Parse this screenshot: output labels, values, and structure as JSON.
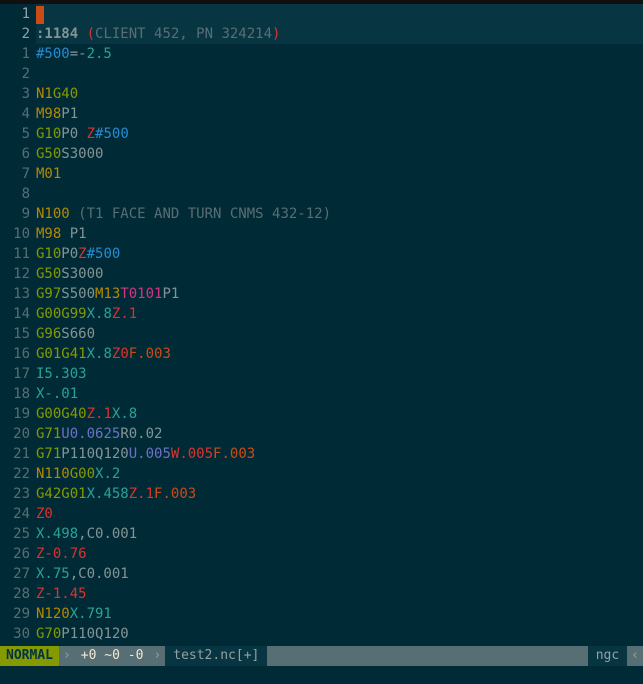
{
  "header_gutter": [
    "1",
    "2"
  ],
  "header_lines": [
    [],
    [
      {
        "t": ":1184 ",
        "c": "t-base0 t-bold"
      },
      {
        "t": "(",
        "c": "paren-hl"
      },
      {
        "t": "CLIENT 452, PN 324214",
        "c": "t-base01"
      },
      {
        "t": ")",
        "c": "paren-hl"
      }
    ]
  ],
  "cursor_line_index": 1,
  "lines": [
    [
      {
        "t": "#500",
        "c": "t-blue"
      },
      {
        "t": "=-",
        "c": "t-base0"
      },
      {
        "t": "2.5",
        "c": "t-cyan"
      }
    ],
    [],
    [
      {
        "t": "N1",
        "c": "t-yellow"
      },
      {
        "t": "G40",
        "c": "t-green"
      }
    ],
    [
      {
        "t": "M98",
        "c": "t-yellow"
      },
      {
        "t": "P1",
        "c": "t-base0"
      }
    ],
    [
      {
        "t": "G10",
        "c": "t-green"
      },
      {
        "t": "P0",
        "c": "t-base0"
      },
      {
        "t": " ",
        "c": ""
      },
      {
        "t": "Z",
        "c": "t-red"
      },
      {
        "t": "#500",
        "c": "t-blue"
      }
    ],
    [
      {
        "t": "G50",
        "c": "t-green"
      },
      {
        "t": "S3000",
        "c": "t-base0"
      }
    ],
    [
      {
        "t": "M01",
        "c": "t-yellow"
      }
    ],
    [],
    [
      {
        "t": "N100",
        "c": "t-yellow"
      },
      {
        "t": " ",
        "c": ""
      },
      {
        "t": "(T1 FACE AND TURN CNMS 432-12)",
        "c": "t-base01"
      }
    ],
    [
      {
        "t": "M98",
        "c": "t-yellow"
      },
      {
        "t": " P1",
        "c": "t-base0"
      }
    ],
    [
      {
        "t": "G10",
        "c": "t-green"
      },
      {
        "t": "P0",
        "c": "t-base0"
      },
      {
        "t": "Z",
        "c": "t-red"
      },
      {
        "t": "#500",
        "c": "t-blue"
      }
    ],
    [
      {
        "t": "G50",
        "c": "t-green"
      },
      {
        "t": "S3000",
        "c": "t-base0"
      }
    ],
    [
      {
        "t": "G97",
        "c": "t-green"
      },
      {
        "t": "S500",
        "c": "t-base0"
      },
      {
        "t": "M13",
        "c": "t-yellow"
      },
      {
        "t": "T0101",
        "c": "t-magenta"
      },
      {
        "t": "P1",
        "c": "t-base0"
      }
    ],
    [
      {
        "t": "G00",
        "c": "t-green"
      },
      {
        "t": "G99",
        "c": "t-green"
      },
      {
        "t": "X.8",
        "c": "t-cyan"
      },
      {
        "t": "Z.1",
        "c": "t-red"
      }
    ],
    [
      {
        "t": "G96",
        "c": "t-green"
      },
      {
        "t": "S660",
        "c": "t-base0"
      }
    ],
    [
      {
        "t": "G01",
        "c": "t-green"
      },
      {
        "t": "G41",
        "c": "t-green"
      },
      {
        "t": "X.8",
        "c": "t-cyan"
      },
      {
        "t": "Z0",
        "c": "t-red"
      },
      {
        "t": "F.003",
        "c": "t-orange"
      }
    ],
    [
      {
        "t": "I5.303",
        "c": "t-cyan"
      }
    ],
    [
      {
        "t": "X-.01",
        "c": "t-cyan"
      }
    ],
    [
      {
        "t": "G00",
        "c": "t-green"
      },
      {
        "t": "G40",
        "c": "t-green"
      },
      {
        "t": "Z.1",
        "c": "t-red"
      },
      {
        "t": "X.8",
        "c": "t-cyan"
      }
    ],
    [
      {
        "t": "G71",
        "c": "t-green"
      },
      {
        "t": "U0.0625",
        "c": "t-violet"
      },
      {
        "t": "R0.02",
        "c": "t-base0"
      }
    ],
    [
      {
        "t": "G71",
        "c": "t-green"
      },
      {
        "t": "P110Q120",
        "c": "t-base0"
      },
      {
        "t": "U.005",
        "c": "t-violet"
      },
      {
        "t": "W.005",
        "c": "t-red"
      },
      {
        "t": "F.003",
        "c": "t-orange"
      }
    ],
    [
      {
        "t": "N110",
        "c": "t-yellow"
      },
      {
        "t": "G00",
        "c": "t-green"
      },
      {
        "t": "X.2",
        "c": "t-cyan"
      }
    ],
    [
      {
        "t": "G42",
        "c": "t-green"
      },
      {
        "t": "G01",
        "c": "t-green"
      },
      {
        "t": "X.458",
        "c": "t-cyan"
      },
      {
        "t": "Z.1",
        "c": "t-red"
      },
      {
        "t": "F.003",
        "c": "t-orange"
      }
    ],
    [
      {
        "t": "Z0",
        "c": "t-red"
      }
    ],
    [
      {
        "t": "X.498",
        "c": "t-cyan"
      },
      {
        "t": ",C0.001",
        "c": "t-base0"
      }
    ],
    [
      {
        "t": "Z-0.76",
        "c": "t-red"
      }
    ],
    [
      {
        "t": "X.75",
        "c": "t-cyan"
      },
      {
        "t": ",C0.001",
        "c": "t-base0"
      }
    ],
    [
      {
        "t": "Z-1.45",
        "c": "t-red"
      }
    ],
    [
      {
        "t": "N120",
        "c": "t-yellow"
      },
      {
        "t": "X.791",
        "c": "t-cyan"
      }
    ],
    [
      {
        "t": "G70",
        "c": "t-green"
      },
      {
        "t": "P110Q120",
        "c": "t-base0"
      }
    ]
  ],
  "status": {
    "mode": "NORMAL",
    "vcs": "+0 ~0 -0",
    "file": "test2.nc[+]",
    "filetype": "ngc"
  },
  "chart_data": null
}
